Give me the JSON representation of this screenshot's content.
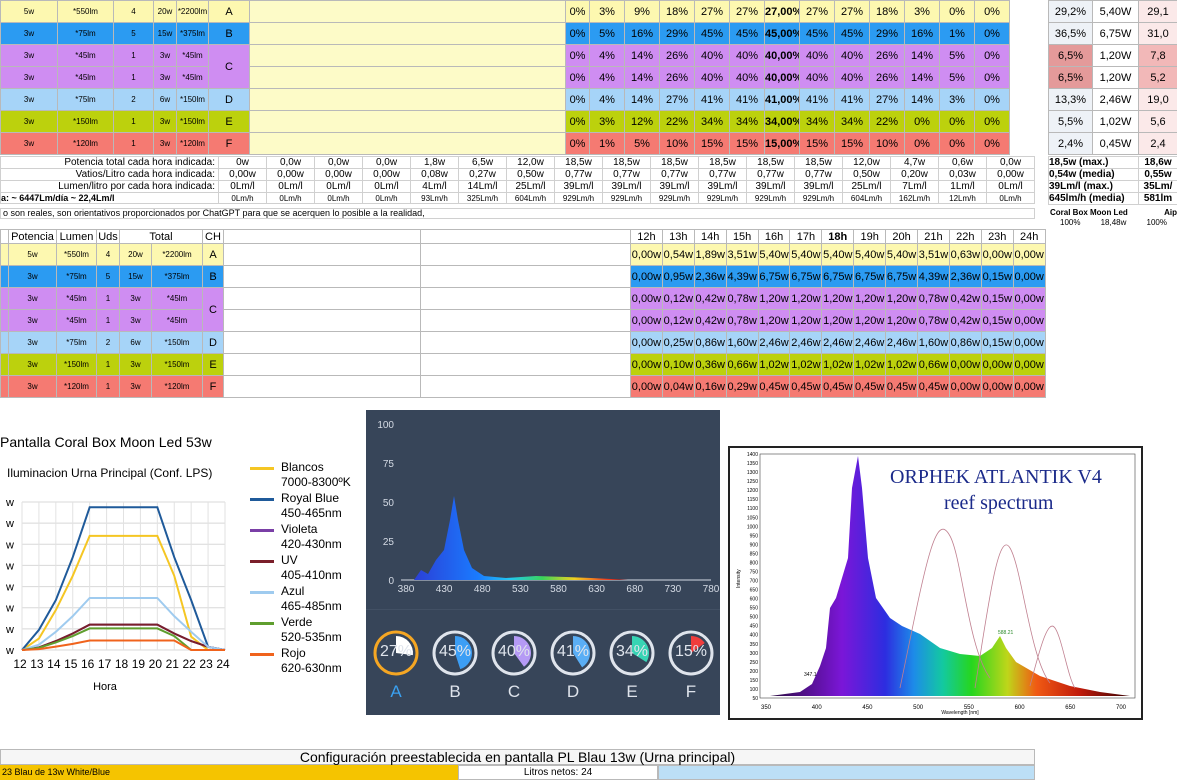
{
  "colors": {
    "A": "#fdf8b0",
    "B": "#2b9bf2",
    "C": "#cf8df2",
    "D": "#a6d4f8",
    "E": "#bcd10d",
    "F": "#f57a72",
    "header_gray": "#f2f2f2"
  },
  "top_rows": [
    {
      "ch": "A",
      "pw": "5w",
      "lm": "*550lm",
      "uds": "4",
      "tot": "20w",
      "totlm": "*2200lm",
      "vals": [
        "0%",
        "3%",
        "9%",
        "18%",
        "27%",
        "27%",
        "27,00%",
        "27%",
        "27%",
        "18%",
        "3%",
        "0%",
        "0%"
      ],
      "r1": "29,2%",
      "r2": "5,40W",
      "r3": "29,1"
    },
    {
      "ch": "B",
      "pw": "3w",
      "lm": "*75lm",
      "uds": "5",
      "tot": "15w",
      "totlm": "*375lm",
      "vals": [
        "0%",
        "5%",
        "16%",
        "29%",
        "45%",
        "45%",
        "45,00%",
        "45%",
        "45%",
        "29%",
        "16%",
        "1%",
        "0%"
      ],
      "r1": "36,5%",
      "r2": "6,75W",
      "r3": "31,0"
    },
    {
      "ch": "C",
      "pw": "3w",
      "lm": "*45lm",
      "uds": "1",
      "tot": "3w",
      "totlm": "*45lm",
      "vals": [
        "0%",
        "4%",
        "14%",
        "26%",
        "40%",
        "40%",
        "40,00%",
        "40%",
        "40%",
        "26%",
        "14%",
        "5%",
        "0%"
      ],
      "r1": "6,5%",
      "r2": "1,20W",
      "r3": "7,8"
    },
    {
      "ch": "",
      "pw": "3w",
      "lm": "*45lm",
      "uds": "1",
      "tot": "3w",
      "totlm": "*45lm",
      "vals": [
        "0%",
        "4%",
        "14%",
        "26%",
        "40%",
        "40%",
        "40,00%",
        "40%",
        "40%",
        "26%",
        "14%",
        "5%",
        "0%"
      ],
      "r1": "6,5%",
      "r2": "1,20W",
      "r3": "5,2"
    },
    {
      "ch": "D",
      "pw": "3w",
      "lm": "*75lm",
      "uds": "2",
      "tot": "6w",
      "totlm": "*150lm",
      "vals": [
        "0%",
        "4%",
        "14%",
        "27%",
        "41%",
        "41%",
        "41,00%",
        "41%",
        "41%",
        "27%",
        "14%",
        "3%",
        "0%"
      ],
      "r1": "13,3%",
      "r2": "2,46W",
      "r3": "19,0"
    },
    {
      "ch": "E",
      "pw": "3w",
      "lm": "*150lm",
      "uds": "1",
      "tot": "3w",
      "totlm": "*150lm",
      "vals": [
        "0%",
        "3%",
        "12%",
        "22%",
        "34%",
        "34%",
        "34,00%",
        "34%",
        "34%",
        "22%",
        "0%",
        "0%",
        "0%"
      ],
      "r1": "5,5%",
      "r2": "1,02W",
      "r3": "5,6"
    },
    {
      "ch": "F",
      "pw": "3w",
      "lm": "*120lm",
      "uds": "1",
      "tot": "3w",
      "totlm": "*120lm",
      "vals": [
        "0%",
        "1%",
        "5%",
        "10%",
        "15%",
        "15%",
        "15,00%",
        "15%",
        "15%",
        "10%",
        "0%",
        "0%",
        "0%"
      ],
      "r1": "2,4%",
      "r2": "0,45W",
      "r3": "2,4"
    }
  ],
  "stats": [
    {
      "label": "Potencia total cada hora indicada:",
      "vals": [
        "0w",
        "0w",
        "0,0w",
        "0,0w",
        "0,0w",
        "1,8w",
        "6,5w",
        "12,0w",
        "18,5w",
        "18,5w",
        "18,5w",
        "18,5w",
        "18,5w",
        "18,5w",
        "12,0w",
        "4,7w",
        "0,6w",
        "0,0w"
      ],
      "r1": "18,5w (max.)",
      "r2": "18,6w"
    },
    {
      "label": "Vatios/Litro cada hora indicada:",
      "vals": [
        "0,00w",
        "0,00w",
        "0,00w",
        "0,00w",
        "0,00w",
        "0,08w",
        "0,27w",
        "0,50w",
        "0,77w",
        "0,77w",
        "0,77w",
        "0,77w",
        "0,77w",
        "0,77w",
        "0,50w",
        "0,20w",
        "0,03w",
        "0,00w"
      ],
      "r1": "0,54w (media)",
      "r2": "0,55w"
    },
    {
      "label": "Lumen/litro por cada hora indicada:",
      "vals": [
        "0Lm/l",
        "0Lm/l",
        "0Lm/l",
        "0Lm/l",
        "0Lm/l",
        "4Lm/l",
        "14Lm/l",
        "25Lm/l",
        "39Lm/l",
        "39Lm/l",
        "39Lm/l",
        "39Lm/l",
        "39Lm/l",
        "39Lm/l",
        "25Lm/l",
        "7Lm/l",
        "1Lm/l",
        "0Lm/l"
      ],
      "r1": "39Lm/l (max.)",
      "r2": "35Lm/"
    },
    {
      "label": "a:     ~  6447Lm/día          ~  22,4Lm/l",
      "vals": [
        "0Lm/h",
        "0Lm/h",
        "0Lm/h",
        "0Lm/h",
        "0Lm/h",
        "93Lm/h",
        "325Lm/h",
        "604Lm/h",
        "929Lm/h",
        "929Lm/h",
        "929Lm/h",
        "929Lm/h",
        "929Lm/h",
        "929Lm/h",
        "604Lm/h",
        "162Lm/h",
        "12Lm/h",
        "0Lm/h"
      ],
      "r1": "645lm/h (media)",
      "r2": "581lm"
    }
  ],
  "note": "o son reales, son orientativos proporcionados por ChatGPT para que se acerquen lo posible a la realidad,",
  "side_note": {
    "a": "Coral Box Moon Led",
    "b": "Aip",
    "c": "100%",
    "d": "18,48w",
    "e": "100%"
  },
  "second_header": {
    "potencia": "Potencia",
    "lumen": "Lumen",
    "uds": "Uds",
    "total": "Total",
    "ch": "CH",
    "hours": [
      "12h",
      "13h",
      "14h",
      "15h",
      "16h",
      "17h",
      "18h",
      "19h",
      "20h",
      "21h",
      "22h",
      "23h",
      "24h"
    ]
  },
  "second_rows": [
    {
      "ch": "A",
      "pw": "5w",
      "lm": "*550lm",
      "uds": "4",
      "tot": "20w",
      "totlm": "*2200lm",
      "vals": [
        "0,00w",
        "0,54w",
        "1,89w",
        "3,51w",
        "5,40w",
        "5,40w",
        "5,40w",
        "5,40w",
        "5,40w",
        "3,51w",
        "0,63w",
        "0,00w",
        "0,00w"
      ]
    },
    {
      "ch": "B",
      "pw": "3w",
      "lm": "*75lm",
      "uds": "5",
      "tot": "15w",
      "totlm": "*375lm",
      "vals": [
        "0,00w",
        "0,95w",
        "2,36w",
        "4,39w",
        "6,75w",
        "6,75w",
        "6,75w",
        "6,75w",
        "6,75w",
        "4,39w",
        "2,36w",
        "0,15w",
        "0,00w"
      ]
    },
    {
      "ch": "C",
      "pw": "3w",
      "lm": "*45lm",
      "uds": "1",
      "tot": "3w",
      "totlm": "*45lm",
      "vals": [
        "0,00w",
        "0,12w",
        "0,42w",
        "0,78w",
        "1,20w",
        "1,20w",
        "1,20w",
        "1,20w",
        "1,20w",
        "0,78w",
        "0,42w",
        "0,15w",
        "0,00w"
      ]
    },
    {
      "ch": "",
      "pw": "3w",
      "lm": "*45lm",
      "uds": "1",
      "tot": "3w",
      "totlm": "*45lm",
      "vals": [
        "0,00w",
        "0,12w",
        "0,42w",
        "0,78w",
        "1,20w",
        "1,20w",
        "1,20w",
        "1,20w",
        "1,20w",
        "0,78w",
        "0,42w",
        "0,15w",
        "0,00w"
      ]
    },
    {
      "ch": "D",
      "pw": "3w",
      "lm": "*75lm",
      "uds": "2",
      "tot": "6w",
      "totlm": "*150lm",
      "vals": [
        "0,00w",
        "0,25w",
        "0,86w",
        "1,60w",
        "2,46w",
        "2,46w",
        "2,46w",
        "2,46w",
        "2,46w",
        "1,60w",
        "0,86w",
        "0,15w",
        "0,00w"
      ]
    },
    {
      "ch": "E",
      "pw": "3w",
      "lm": "*150lm",
      "uds": "1",
      "tot": "3w",
      "totlm": "*150lm",
      "vals": [
        "0,00w",
        "0,10w",
        "0,36w",
        "0,66w",
        "1,02w",
        "1,02w",
        "1,02w",
        "1,02w",
        "1,02w",
        "0,66w",
        "0,00w",
        "0,00w",
        "0,00w"
      ]
    },
    {
      "ch": "F",
      "pw": "3w",
      "lm": "*120lm",
      "uds": "1",
      "tot": "3w",
      "totlm": "*120lm",
      "vals": [
        "0,00w",
        "0,04w",
        "0,16w",
        "0,29w",
        "0,45w",
        "0,45w",
        "0,45w",
        "0,45w",
        "0,45w",
        "0,45w",
        "0,00w",
        "0,00w",
        "0,00w"
      ]
    }
  ],
  "chart": {
    "title": "Pantalla Coral Box Moon Led 53w",
    "subtitle": "Iluminacion Urna Principal (Conf. LPS)",
    "xlabel": "Hora"
  },
  "chart_data": {
    "type": "line",
    "x": [
      "12",
      "13",
      "14",
      "15",
      "16",
      "17",
      "18",
      "19",
      "20",
      "21",
      "22",
      "23",
      "24"
    ],
    "xlabel": "Hora",
    "series": [
      {
        "name": "Blancos 7000-8300ºK",
        "color": "#f5c623",
        "values": [
          0,
          0.54,
          1.89,
          3.51,
          5.4,
          5.4,
          5.4,
          5.4,
          5.4,
          3.51,
          0.63,
          0,
          0
        ]
      },
      {
        "name": "Royal Blue 450-465nm",
        "color": "#1f5a9a",
        "values": [
          0,
          0.95,
          2.36,
          4.39,
          6.75,
          6.75,
          6.75,
          6.75,
          6.75,
          4.39,
          2.36,
          0.15,
          0
        ]
      },
      {
        "name": "Violeta 420-430nm",
        "color": "#7a3fa6",
        "values": [
          0,
          0.12,
          0.42,
          0.78,
          1.2,
          1.2,
          1.2,
          1.2,
          1.2,
          0.78,
          0.42,
          0.15,
          0
        ]
      },
      {
        "name": "UV 405-410nm",
        "color": "#7a1f2a",
        "values": [
          0,
          0.12,
          0.42,
          0.78,
          1.2,
          1.2,
          1.2,
          1.2,
          1.2,
          0.78,
          0.42,
          0.15,
          0
        ]
      },
      {
        "name": "Azul 465-485nm",
        "color": "#9fcbef",
        "values": [
          0,
          0.25,
          0.86,
          1.6,
          2.46,
          2.46,
          2.46,
          2.46,
          2.46,
          1.6,
          0.86,
          0.15,
          0
        ]
      },
      {
        "name": "Verde 520-535nm",
        "color": "#5f9e2e",
        "values": [
          0,
          0.1,
          0.36,
          0.66,
          1.02,
          1.02,
          1.02,
          1.02,
          1.02,
          0.66,
          0,
          0,
          0
        ]
      },
      {
        "name": "Rojo 620-630nm",
        "color": "#f0631c",
        "values": [
          0,
          0.04,
          0.16,
          0.29,
          0.45,
          0.45,
          0.45,
          0.45,
          0.45,
          0.45,
          0,
          0,
          0
        ]
      }
    ],
    "ylim": [
      0,
      7
    ]
  },
  "legend": [
    {
      "a": "Blancos",
      "b": "7000-8300ºK",
      "color": "#f5c623"
    },
    {
      "a": "Royal Blue",
      "b": "450-465nm",
      "color": "#1f5a9a"
    },
    {
      "a": "Violeta",
      "b": "420-430nm",
      "color": "#7a3fa6"
    },
    {
      "a": "UV",
      "b": "405-410nm",
      "color": "#7a1f2a"
    },
    {
      "a": "Azul",
      "b": "465-485nm",
      "color": "#9fcbef"
    },
    {
      "a": "Verde",
      "b": "520-535nm",
      "color": "#5f9e2e"
    },
    {
      "a": "Rojo",
      "b": "620-630nm",
      "color": "#f0631c"
    }
  ],
  "spectrum": {
    "yticks": [
      "100",
      "75",
      "50",
      "25",
      "0"
    ],
    "xticks": [
      "380",
      "430",
      "480",
      "530",
      "580",
      "630",
      "680",
      "730",
      "780"
    ]
  },
  "dials": [
    {
      "id": "A",
      "pct": "27%",
      "value": 27,
      "color": "#ffffff",
      "ring": "#f5a623"
    },
    {
      "id": "B",
      "pct": "45%",
      "value": 45,
      "color": "#3c9ef5",
      "ring": "#dfe4ec"
    },
    {
      "id": "C",
      "pct": "40%",
      "value": 40,
      "color": "#b59af5",
      "ring": "#dfe4ec"
    },
    {
      "id": "D",
      "pct": "41%",
      "value": 41,
      "color": "#5aaef5",
      "ring": "#dfe4ec"
    },
    {
      "id": "E",
      "pct": "34%",
      "value": 34,
      "color": "#37d4b4",
      "ring": "#dfe4ec"
    },
    {
      "id": "F",
      "pct": "15%",
      "value": 15,
      "color": "#f03c3c",
      "ring": "#dfe4ec"
    }
  ],
  "orphek": {
    "title": "ORPHEK ATLANTIK V4",
    "sub": "reef spectrum",
    "xticks": [
      "350",
      "400",
      "450",
      "500",
      "550",
      "600",
      "650",
      "700"
    ],
    "yticks": [
      "1400",
      "1350",
      "1300",
      "1250",
      "1200",
      "1150",
      "1100",
      "1050",
      "1000",
      "950",
      "900",
      "850",
      "800",
      "750",
      "700",
      "650",
      "600",
      "550",
      "500",
      "450",
      "400",
      "350",
      "300",
      "250",
      "200",
      "150",
      "100",
      "50"
    ],
    "ylabel": "Intensity",
    "xlabel": "Wavelength [nm]",
    "peak1": "588.21",
    "peak2": "347.1"
  },
  "bottom": {
    "title": "Configuración preestablecida en pantalla PL Blau 13w (Urna principal)",
    "left": "23  Blau  de  13w  White/Blue",
    "mid": "Litros netos: 24"
  }
}
